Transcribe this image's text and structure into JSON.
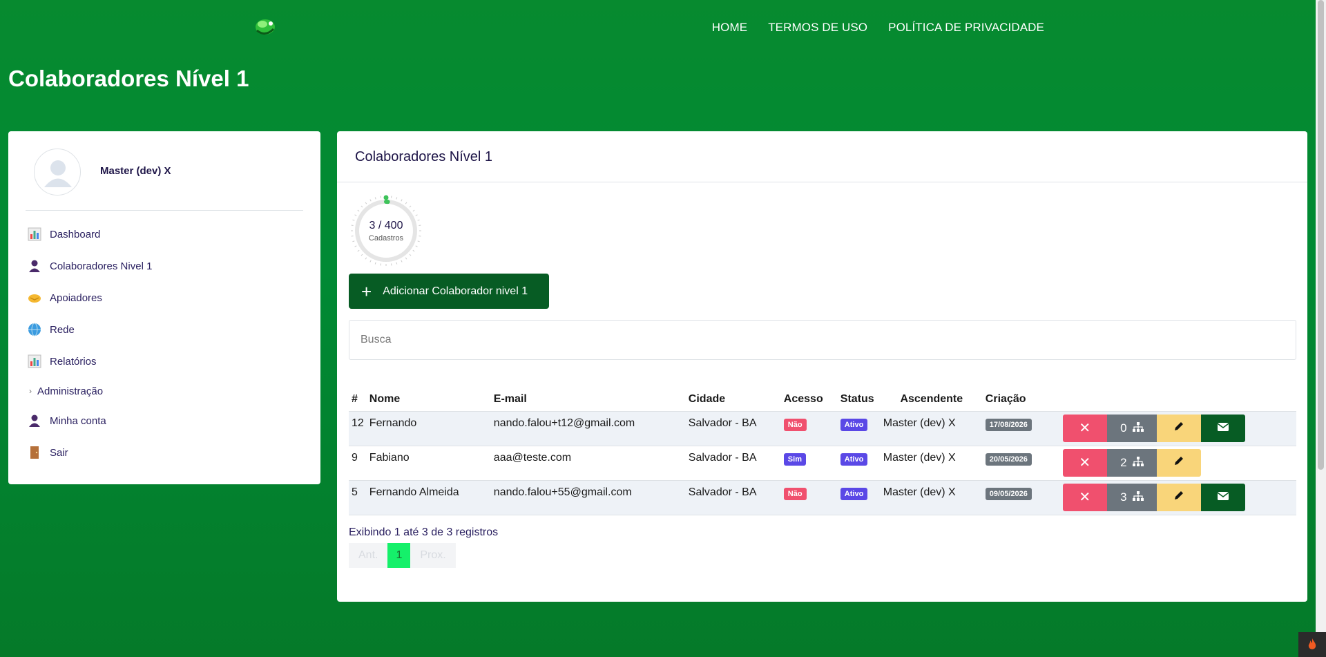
{
  "nav": {
    "home": "HOME",
    "terms": "TERMOS DE USO",
    "privacy": "POLÍTICA DE PRIVACIDADE"
  },
  "page_title": "Colaboradores Nível 1",
  "sidebar": {
    "user_name": "Master (dev) X",
    "items": [
      {
        "label": "Dashboard",
        "icon": "chart-icon"
      },
      {
        "label": "Colaboradores Nivel 1",
        "icon": "person-icon"
      },
      {
        "label": "Apoiadores",
        "icon": "handshake-icon"
      },
      {
        "label": "Rede",
        "icon": "globe-icon"
      },
      {
        "label": "Relatórios",
        "icon": "chart-icon"
      },
      {
        "label": "Administração",
        "icon": "chevron-right-icon"
      },
      {
        "label": "Minha conta",
        "icon": "person-icon"
      },
      {
        "label": "Sair",
        "icon": "door-icon"
      }
    ]
  },
  "main": {
    "card_title": "Colaboradores Nível 1",
    "gauge": {
      "value": "3 / 400",
      "label": "Cadastros",
      "fraction": 0.0075
    },
    "add_button": "Adicionar Colaborador nivel 1",
    "search_placeholder": "Busca",
    "table": {
      "headers": [
        "#",
        "Nome",
        "E-mail",
        "Cidade",
        "Acesso",
        "Status",
        "Ascendente",
        "Criação"
      ],
      "rows": [
        {
          "id": "12",
          "nome": "Fernando",
          "email": "nando.falou+t12@gmail.com",
          "cidade": "Salvador - BA",
          "acesso": "Não",
          "status": "Ativo",
          "ascendente": "Master (dev) X",
          "criacao": "17/08/2026",
          "rede": "0",
          "mail": true
        },
        {
          "id": "9",
          "nome": "Fabiano",
          "email": "aaa@teste.com",
          "cidade": "Salvador - BA",
          "acesso": "Sim",
          "status": "Ativo",
          "ascendente": "Master (dev) X",
          "criacao": "20/05/2026",
          "rede": "2",
          "mail": false
        },
        {
          "id": "5",
          "nome": "Fernando Almeida",
          "email": "nando.falou+55@gmail.com",
          "cidade": "Salvador - BA",
          "acesso": "Não",
          "status": "Ativo",
          "ascendente": "Master (dev) X",
          "criacao": "09/05/2026",
          "rede": "3",
          "mail": true
        }
      ]
    },
    "info": "Exibindo 1 até 3 de 3 registros",
    "pager": {
      "prev": "Ant.",
      "current": "1",
      "next": "Prox."
    }
  },
  "colors": {
    "brand_green": "#008a34",
    "dark_green": "#075c24",
    "danger": "#f0506e",
    "warning": "#f9d57a",
    "badge_purple": "#5a48e6"
  }
}
